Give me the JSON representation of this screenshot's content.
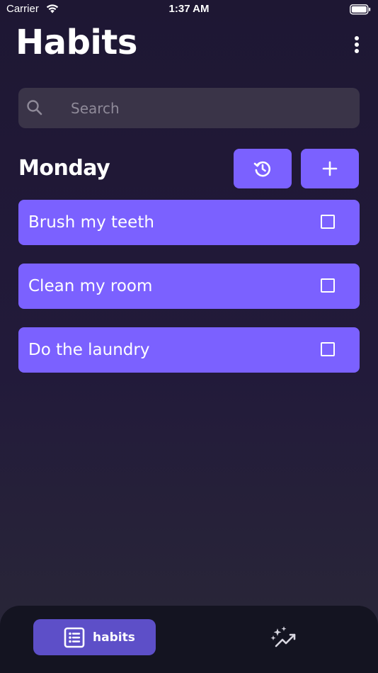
{
  "status_bar": {
    "carrier": "Carrier",
    "time": "1:37 AM"
  },
  "header": {
    "title": "Habits",
    "menu_icon": "more-vertical-icon"
  },
  "search": {
    "placeholder": "Search",
    "value": "",
    "icon": "search-icon"
  },
  "day": {
    "title": "Monday",
    "reset_icon": "history-icon",
    "add_icon": "plus-icon"
  },
  "habits": [
    {
      "label": "Brush my teeth",
      "checked": false
    },
    {
      "label": "Clean my room",
      "checked": false
    },
    {
      "label": "Do the laundry",
      "checked": false
    }
  ],
  "bottom_nav": {
    "items": [
      {
        "label": "habits",
        "icon": "list-icon",
        "active": true
      },
      {
        "label": "",
        "icon": "sparkle-chart-icon",
        "active": false
      }
    ]
  },
  "colors": {
    "accent": "#7b61ff",
    "nav_active": "#5d4fc8",
    "background_top": "#1e1733",
    "search_bg": "#3a3448",
    "nav_bg": "#141421"
  }
}
